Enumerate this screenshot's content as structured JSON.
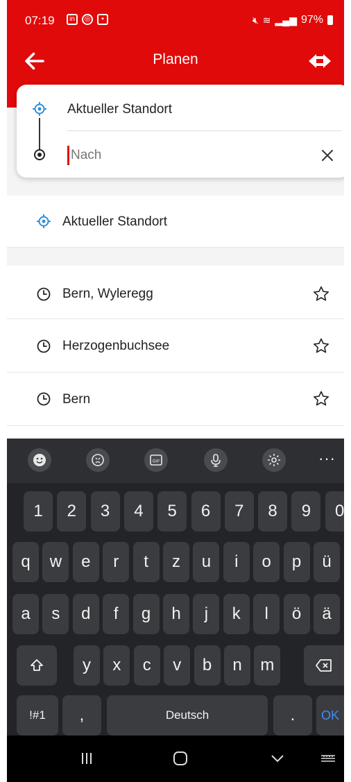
{
  "status_bar": {
    "time": "07:19",
    "battery": "97%",
    "icons": [
      "linkedin-icon",
      "location-icon",
      "app-icon"
    ],
    "right_icons": [
      "mute-icon",
      "wifi-icon",
      "volte-icon",
      "signal-icon",
      "battery-icon"
    ]
  },
  "app_bar": {
    "title": "Planen",
    "back_icon": "arrow-left-icon",
    "logo": "sbb-logo"
  },
  "route": {
    "from": "Aktueller Standort",
    "to_placeholder": "Nach",
    "to_value": ""
  },
  "current_location": {
    "label": "Aktueller Standort"
  },
  "history": [
    {
      "label": "Bern, Wyleregg"
    },
    {
      "label": "Herzogenbuchsee"
    },
    {
      "label": "Bern"
    }
  ],
  "keyboard": {
    "toolbar": [
      "emoji-icon",
      "sticker-icon",
      "gif-icon",
      "microphone-icon",
      "settings-icon",
      "more-icon"
    ],
    "number_row": [
      "1",
      "2",
      "3",
      "4",
      "5",
      "6",
      "7",
      "8",
      "9",
      "0"
    ],
    "row1": [
      "q",
      "w",
      "e",
      "r",
      "t",
      "z",
      "u",
      "i",
      "o",
      "p",
      "ü"
    ],
    "row2": [
      "a",
      "s",
      "d",
      "f",
      "g",
      "h",
      "j",
      "k",
      "l",
      "ö",
      "ä"
    ],
    "row3": [
      "y",
      "x",
      "c",
      "v",
      "b",
      "n",
      "m"
    ],
    "symbols_key": "!#1",
    "comma_key": ",",
    "space_label": "Deutsch",
    "period_key": ".",
    "ok_label": "OK"
  },
  "colors": {
    "brand_red": "#e10a0a",
    "keyboard_bg": "#232427",
    "key_bg": "#3b3c40",
    "accent_blue": "#3d8ef0",
    "location_blue": "#2f8fd8"
  }
}
